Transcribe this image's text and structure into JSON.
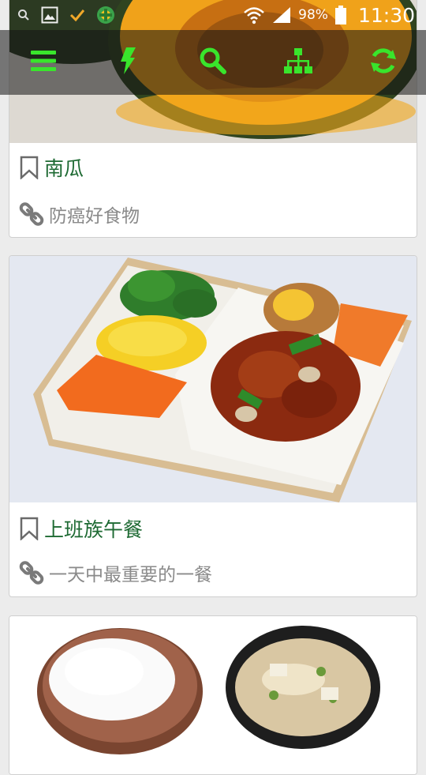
{
  "status_bar": {
    "battery": "98%",
    "time": "11:30",
    "icons": [
      "search-icon",
      "image-icon",
      "check-icon",
      "app-icon",
      "wifi-icon",
      "signal-icon",
      "battery-icon"
    ]
  },
  "action_bar": {
    "icons": [
      "menu-icon",
      "flash-icon",
      "search-icon",
      "sitemap-icon",
      "refresh-icon"
    ],
    "accent": "#39e52c"
  },
  "cards": [
    {
      "title": "南瓜",
      "subtitle": "防癌好食物",
      "image": "pumpkin-image"
    },
    {
      "title": "上班族午餐",
      "subtitle": "一天中最重要的一餐",
      "image": "bento-lunch-image"
    },
    {
      "title": "",
      "subtitle": "",
      "image": "rice-and-miso-soup-image"
    }
  ],
  "colors": {
    "title": "#1e6a33",
    "subtitle": "#8a8a8a",
    "background": "#ececec"
  }
}
